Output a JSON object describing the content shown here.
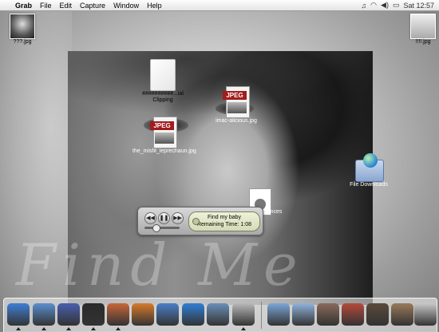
{
  "menubar": {
    "app_name": "Grab",
    "menus": [
      "File",
      "Edit",
      "Capture",
      "Window",
      "Help"
    ],
    "clock": "Sat 12:57"
  },
  "desktop": {
    "icons": [
      {
        "label": "???.jpg"
      },
      {
        "label": "!!!!.jpg"
      },
      {
        "label": "##########...ial Clipping"
      },
      {
        "label": "imac-alicious.jpg"
      },
      {
        "label": "the_misfit_leprechaun.jpg"
      },
      {
        "label": "File Downloads"
      },
      {
        "label": "...rences"
      }
    ],
    "jpeg_tag": "JPEG",
    "wallpaper_text": "Find Me"
  },
  "player": {
    "track": "Find my baby",
    "remaining": "Remaining Time: 1:08"
  },
  "dock": {
    "items": [
      {
        "icon": "finder-icon",
        "color": "#3f7fd8",
        "running": true
      },
      {
        "icon": "itunes-icon",
        "color": "#5a8fd0",
        "running": true
      },
      {
        "icon": "bbedit-icon",
        "color": "#4a5fb0",
        "running": true
      },
      {
        "icon": "terminal-icon",
        "color": "#2a2a2a",
        "running": true
      },
      {
        "icon": "photo-viewer-icon",
        "color": "#c9663a",
        "running": true
      },
      {
        "icon": "firefox-icon",
        "color": "#d97a2a",
        "running": false
      },
      {
        "icon": "bird-icon",
        "color": "#4a7fc8",
        "running": false
      },
      {
        "icon": "internet-explorer-icon",
        "color": "#2f7fd6",
        "running": false
      },
      {
        "icon": "preview-icon",
        "color": "#6a8fb8",
        "running": false
      },
      {
        "icon": "grab-icon",
        "color": "#b9b9b9",
        "running": true
      },
      {
        "icon": "applications-folder-icon",
        "color": "#7aa6d8",
        "running": false
      },
      {
        "icon": "documents-folder-icon",
        "color": "#8fb3dc",
        "running": false
      },
      {
        "icon": "user-photo-1-icon",
        "color": "#8a6a5a",
        "running": false
      },
      {
        "icon": "user-photo-2-icon",
        "color": "#b64a3a",
        "running": false
      },
      {
        "icon": "user-photo-3-icon",
        "color": "#5a4a3a",
        "running": false
      },
      {
        "icon": "user-photo-4-icon",
        "color": "#9a7a5a",
        "running": false
      },
      {
        "icon": "trash-icon",
        "color": "#c8c8c8",
        "running": false
      }
    ]
  }
}
